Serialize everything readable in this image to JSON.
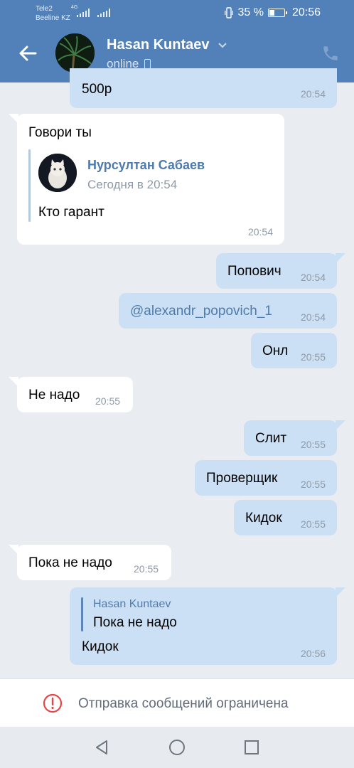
{
  "status_bar": {
    "carrier1": "Tele2",
    "carrier2": "Beeline KZ",
    "network": "4G",
    "battery": "35 %",
    "battery_level": 0.35,
    "time": "20:56"
  },
  "header": {
    "name": "Hasan Kuntaev",
    "status": "online"
  },
  "messages": [
    {
      "text": "500р",
      "time": "20:54"
    },
    {
      "text": "Говори  ты",
      "time": "20:54",
      "quote": {
        "author": "Нурсултан Сабаев",
        "date": "Сегодня в 20:54",
        "text": "Кто гарант"
      }
    },
    {
      "text": "Попович",
      "time": "20:54"
    },
    {
      "text": "@alexandr_popovich_1",
      "time": "20:54"
    },
    {
      "text": "Онл",
      "time": "20:55"
    },
    {
      "text": "Не надо",
      "time": "20:55"
    },
    {
      "text": "Слит",
      "time": "20:55"
    },
    {
      "text": "Проверщик",
      "time": "20:55"
    },
    {
      "text": "Кидок",
      "time": "20:55"
    },
    {
      "text": "Пока не надо",
      "time": "20:55"
    },
    {
      "text": "Кидок",
      "time": "20:56",
      "reply": {
        "author": "Hasan Kuntaev",
        "text": "Пока не надо"
      }
    }
  ],
  "restriction": {
    "text": "Отправка сообщений ограничена"
  },
  "icons": {
    "back": "arrow-left-icon",
    "call": "phone-icon",
    "warning": "warning-circle-icon",
    "nav": [
      "back-triangle-icon",
      "home-circle-icon",
      "recents-square-icon"
    ]
  },
  "colors": {
    "header": "#5181b8",
    "chat_bg": "#e9edf1",
    "incoming_bubble": "#ffffff",
    "outgoing_bubble": "#cce0f5",
    "link": "#4e7bab",
    "warning": "#e64646"
  }
}
